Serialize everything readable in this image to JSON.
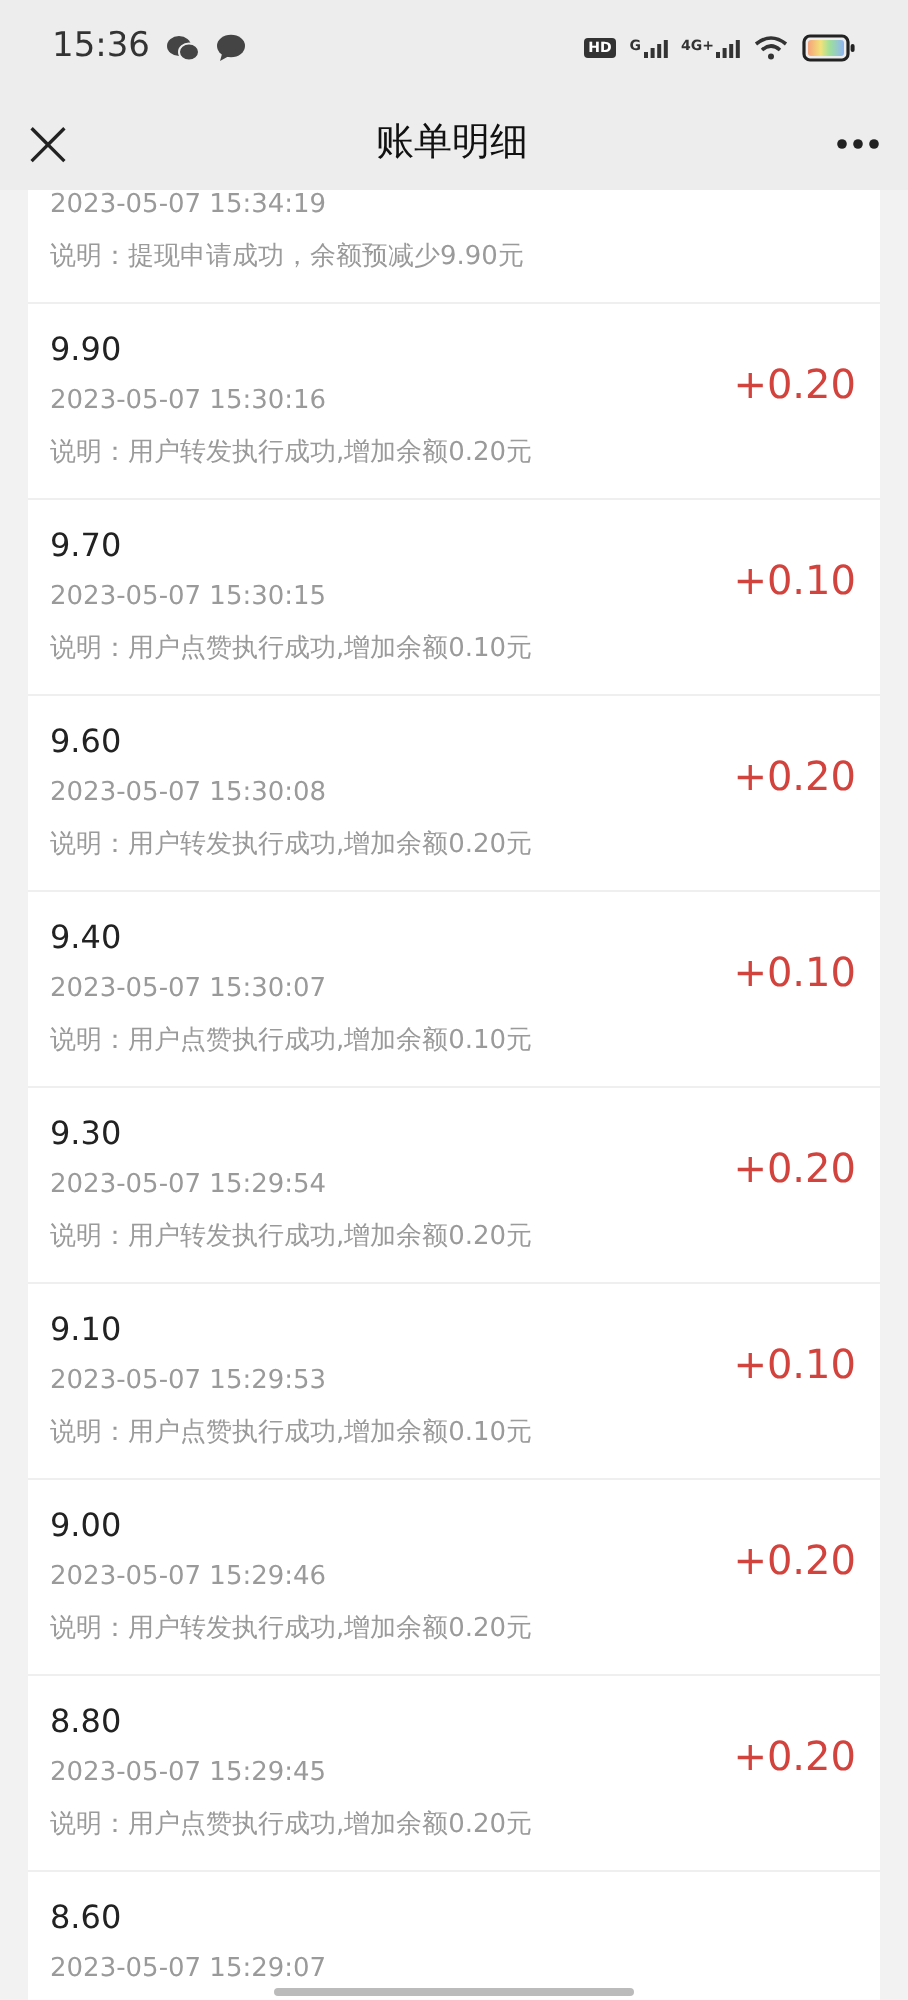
{
  "status_bar": {
    "time": "15:36",
    "hd_badge": "HD",
    "network_labels": [
      "G",
      "4G+"
    ]
  },
  "header": {
    "close": "×",
    "title": "账单明细"
  },
  "records": [
    {
      "time": "2023-05-07 15:34:19",
      "note": "说明：提现申请成功，余额预减少9.90元"
    },
    {
      "balance": "9.90",
      "amount": "+0.20",
      "time": "2023-05-07 15:30:16",
      "note": "说明：用户转发执行成功,增加余额0.20元"
    },
    {
      "balance": "9.70",
      "amount": "+0.10",
      "time": "2023-05-07 15:30:15",
      "note": "说明：用户点赞执行成功,增加余额0.10元"
    },
    {
      "balance": "9.60",
      "amount": "+0.20",
      "time": "2023-05-07 15:30:08",
      "note": "说明：用户转发执行成功,增加余额0.20元"
    },
    {
      "balance": "9.40",
      "amount": "+0.10",
      "time": "2023-05-07 15:30:07",
      "note": "说明：用户点赞执行成功,增加余额0.10元"
    },
    {
      "balance": "9.30",
      "amount": "+0.20",
      "time": "2023-05-07 15:29:54",
      "note": "说明：用户转发执行成功,增加余额0.20元"
    },
    {
      "balance": "9.10",
      "amount": "+0.10",
      "time": "2023-05-07 15:29:53",
      "note": "说明：用户点赞执行成功,增加余额0.10元"
    },
    {
      "balance": "9.00",
      "amount": "+0.20",
      "time": "2023-05-07 15:29:46",
      "note": "说明：用户转发执行成功,增加余额0.20元"
    },
    {
      "balance": "8.80",
      "amount": "+0.20",
      "time": "2023-05-07 15:29:45",
      "note": "说明：用户点赞执行成功,增加余额0.20元"
    },
    {
      "balance": "8.60",
      "time": "2023-05-07 15:29:07"
    }
  ]
}
